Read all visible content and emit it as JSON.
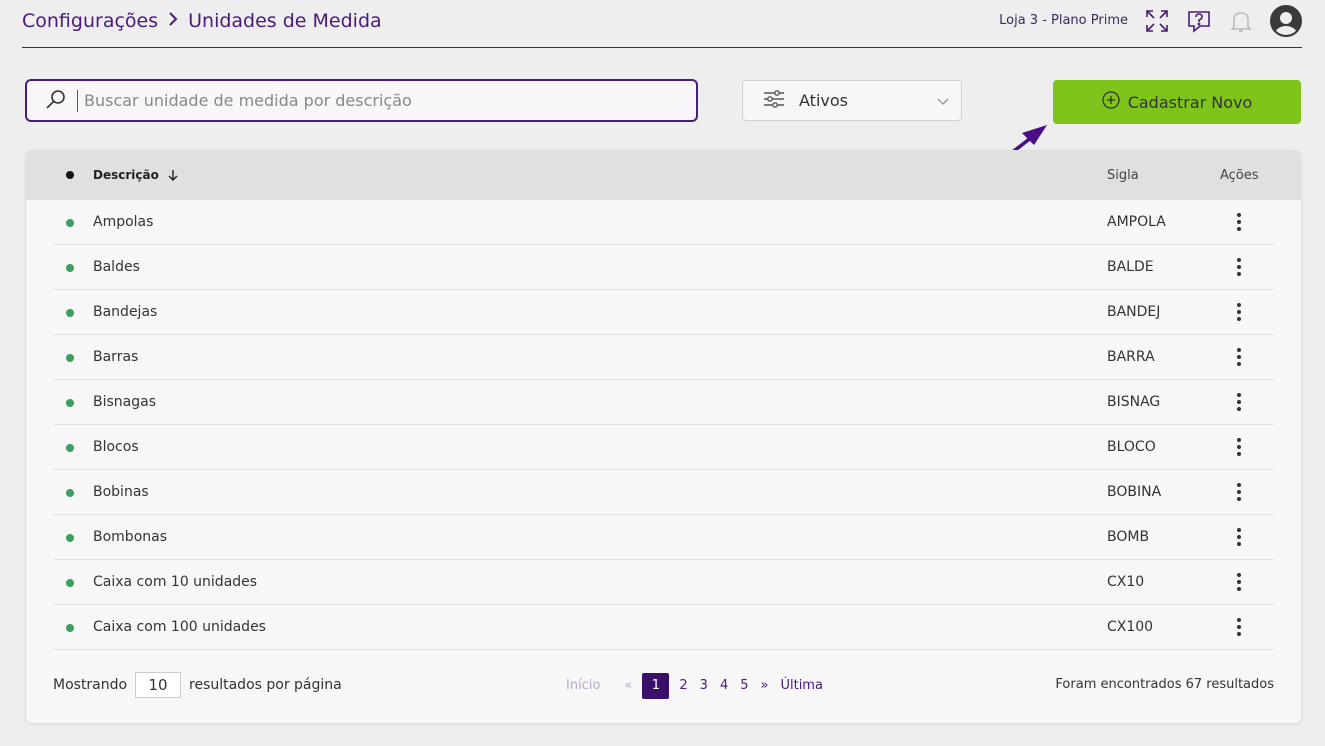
{
  "header": {
    "breadcrumb_parent": "Configurações",
    "breadcrumb_current": "Unidades de Medida",
    "store": "Loja 3 - Plano Prime"
  },
  "toolbar": {
    "search_placeholder": "Buscar unidade de medida por descrição",
    "search_value": "",
    "filter_value": "Ativos",
    "new_button_label": "Cadastrar Novo"
  },
  "table": {
    "col_description": "Descrição",
    "col_sigla": "Sigla",
    "col_actions": "Ações",
    "rows": [
      {
        "name": "Ampolas",
        "sigla": "AMPOLA"
      },
      {
        "name": "Baldes",
        "sigla": "BALDE"
      },
      {
        "name": "Bandejas",
        "sigla": "BANDEJ"
      },
      {
        "name": "Barras",
        "sigla": "BARRA"
      },
      {
        "name": "Bisnagas",
        "sigla": "BISNAG"
      },
      {
        "name": "Blocos",
        "sigla": "BLOCO"
      },
      {
        "name": "Bobinas",
        "sigla": "BOBINA"
      },
      {
        "name": "Bombonas",
        "sigla": "BOMB"
      },
      {
        "name": "Caixa com 10 unidades",
        "sigla": "CX10"
      },
      {
        "name": "Caixa com 100 unidades",
        "sigla": "CX100"
      }
    ]
  },
  "footer": {
    "showing_label": "Mostrando",
    "per_page": "10",
    "per_page_label": "resultados por página",
    "pager_start": "Início",
    "pager_prev": "«",
    "pages": [
      "1",
      "2",
      "3",
      "4",
      "5"
    ],
    "pager_next": "»",
    "pager_last": "Última",
    "found_text": "Foram encontrados 67 resultados"
  },
  "colors": {
    "brand_purple": "#4b1a7a",
    "accent_green": "#7fc41a",
    "active_dot": "#3aa060"
  }
}
